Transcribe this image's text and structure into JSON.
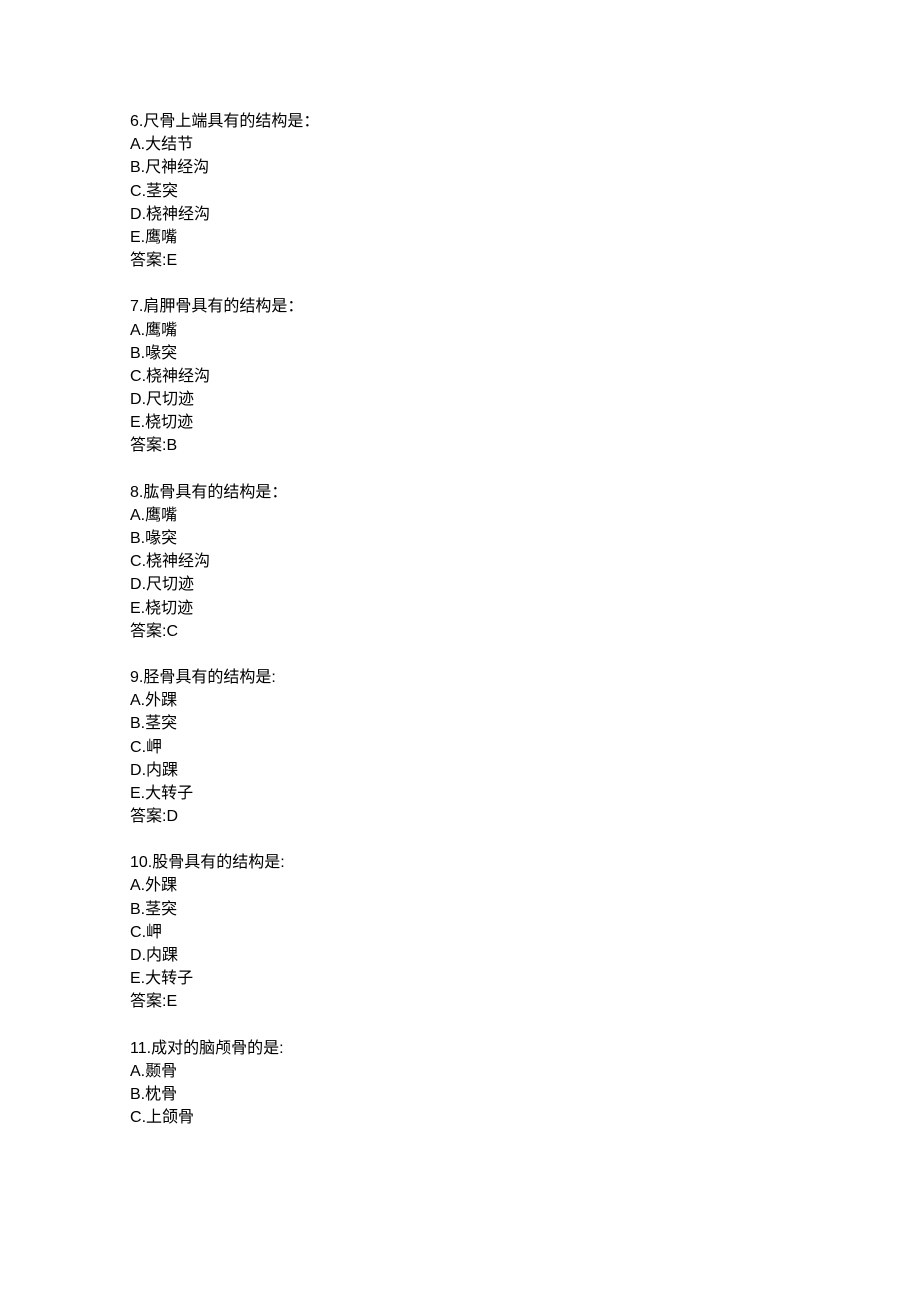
{
  "questions": [
    {
      "number": "6",
      "stem": "尺骨上端具有的结构是：",
      "options": [
        {
          "key": "A",
          "text": "大结节"
        },
        {
          "key": "B",
          "text": "尺神经沟"
        },
        {
          "key": "C",
          "text": "茎突"
        },
        {
          "key": "D",
          "text": "桡神经沟"
        },
        {
          "key": "E",
          "text": "鹰嘴"
        }
      ],
      "answer_label": "答案",
      "answer": "E"
    },
    {
      "number": "7",
      "stem": "肩胛骨具有的结构是：",
      "options": [
        {
          "key": "A",
          "text": "鹰嘴"
        },
        {
          "key": "B",
          "text": "喙突"
        },
        {
          "key": "C",
          "text": "桡神经沟"
        },
        {
          "key": "D",
          "text": "尺切迹"
        },
        {
          "key": "E",
          "text": "桡切迹"
        }
      ],
      "answer_label": "答案",
      "answer": "B"
    },
    {
      "number": "8",
      "stem": "肱骨具有的结构是：",
      "options": [
        {
          "key": "A",
          "text": "鹰嘴"
        },
        {
          "key": "B",
          "text": "喙突"
        },
        {
          "key": "C",
          "text": "桡神经沟"
        },
        {
          "key": "D",
          "text": "尺切迹"
        },
        {
          "key": "E",
          "text": "桡切迹"
        }
      ],
      "answer_label": "答案",
      "answer": "C"
    },
    {
      "number": "9",
      "stem": "胫骨具有的结构是:",
      "options": [
        {
          "key": "A",
          "text": "外踝"
        },
        {
          "key": "B",
          "text": "茎突"
        },
        {
          "key": "C",
          "text": "岬"
        },
        {
          "key": "D",
          "text": "内踝"
        },
        {
          "key": "E",
          "text": "大转子"
        }
      ],
      "answer_label": "答案",
      "answer": "D"
    },
    {
      "number": "10",
      "stem": "股骨具有的结构是:",
      "options": [
        {
          "key": "A",
          "text": "外踝"
        },
        {
          "key": "B",
          "text": "茎突"
        },
        {
          "key": "C",
          "text": "岬"
        },
        {
          "key": "D",
          "text": "内踝"
        },
        {
          "key": "E",
          "text": "大转子"
        }
      ],
      "answer_label": "答案",
      "answer": "E"
    },
    {
      "number": "11",
      "stem": "成对的脑颅骨的是:",
      "options": [
        {
          "key": "A",
          "text": "颞骨"
        },
        {
          "key": "B",
          "text": "枕骨"
        },
        {
          "key": "C",
          "text": "上颌骨"
        }
      ],
      "answer_label": "",
      "answer": ""
    }
  ]
}
